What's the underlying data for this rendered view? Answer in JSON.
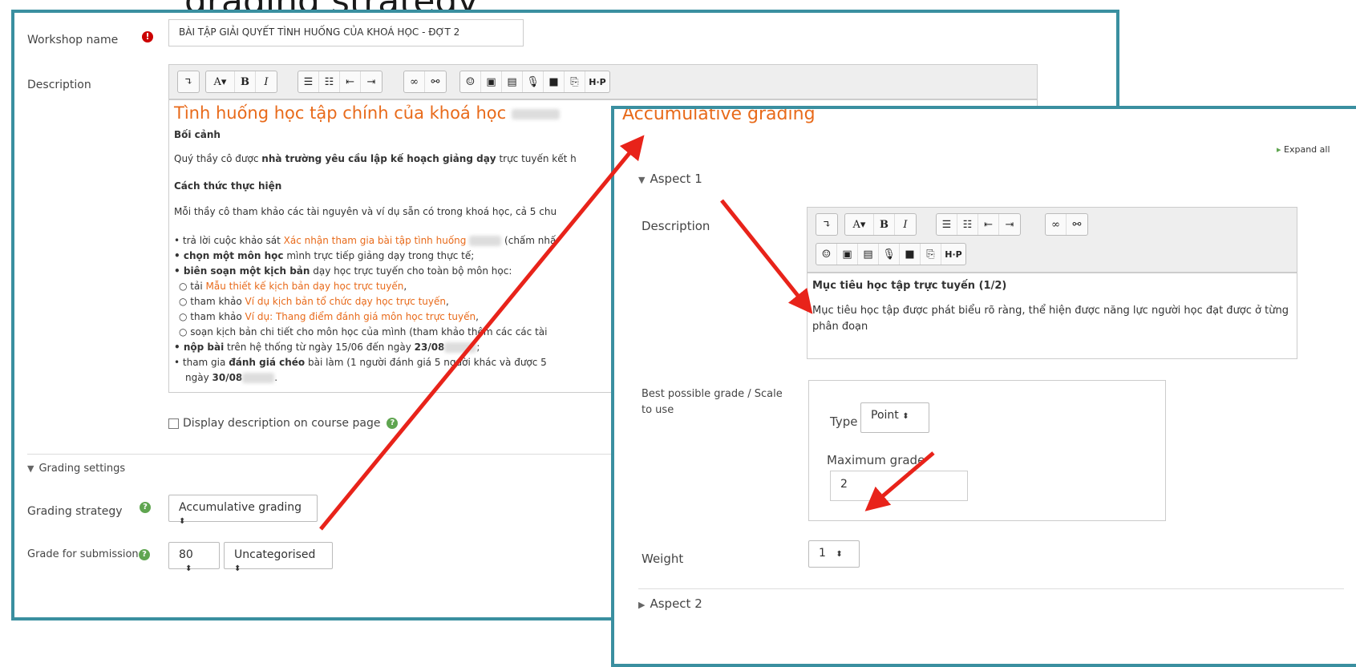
{
  "heading_partial": "grading strategy",
  "left": {
    "workshop_name_label": "Workshop name",
    "workshop_name_value": "BÀI TẬP GIẢI QUYẾT TÌNH HUỐNG CỦA KHOÁ HỌC - ĐỢT 2",
    "description_label": "Description",
    "editor": {
      "title": "Tình huống học tập chính của khoá học",
      "context_heading": "Bối cảnh",
      "context_text_prefix": "Quý thầy cô được ",
      "context_text_bold": "nhà trường yêu cầu lập kế hoạch giảng dạy",
      "context_text_suffix": " trực tuyến kết h",
      "method_heading": "Cách thức thực hiện",
      "method_text": "Mỗi thầy cô tham khảo các tài nguyên và ví dụ sẵn có trong khoá học, cả 5 chu",
      "b1_prefix": "• trả lời cuộc khảo sát ",
      "b1_link": "Xác nhận tham gia bài tập tình huống",
      "b1_suffix": " (chấm nhấ",
      "b2_bold": "• chọn một môn học",
      "b2_text": " mình trực tiếp giảng dạy trong thực tế;",
      "b3_bold": "• biên soạn một kịch bản",
      "b3_text": " dạy học trực tuyến cho toàn bộ môn học:",
      "s1_prefix": "○ tải ",
      "s1_link": "Mẫu thiết kế kịch bản dạy học trực tuyến",
      "s1_suffix": ",",
      "s2_prefix": "○ tham khảo ",
      "s2_link": "Ví dụ kịch bản tổ chức dạy học trực tuyến",
      "s2_suffix": ",",
      "s3_prefix": "○ tham khảo ",
      "s3_link": "Ví dụ: Thang điểm đánh giá môn học trực tuyến",
      "s3_suffix": ",",
      "s4_text": "○ soạn kịch bản chi tiết cho môn học của mình (tham khảo thêm các các tài",
      "b4_bold": "• nộp bài",
      "b4_text": " trên hệ thống từ ngày 15/06 đến ngày ",
      "b4_date": "23/08",
      "b4_end": ";",
      "b5_prefix": "• tham gia ",
      "b5_bold": "đánh giá chéo",
      "b5_text": " bài làm (1 người đánh giá 5 người khác và được 5",
      "b5_line2_prefix": "ngày ",
      "b5_line2_date": "30/08",
      "b5_line2_end": "."
    },
    "display_desc_label": "Display description on course page",
    "grading_settings_label": "Grading settings",
    "grading_strategy_label": "Grading strategy",
    "grading_strategy_value": "Accumulative grading",
    "grade_submission_label": "Grade for submission",
    "grade_value": "80",
    "grade_category": "Uncategorised"
  },
  "right": {
    "title": "Accumulative grading",
    "expand_all": "Expand all",
    "aspect1": "Aspect 1",
    "description_label": "Description",
    "editor_title": "Mục tiêu học tập trực tuyến (1/2)",
    "editor_body": "Mục tiêu học tập được phát biểu rõ ràng, thể hiện được năng lực người học đạt được ở từng phân đoạn",
    "best_grade_label": "Best possible grade / Scale to use",
    "type_label": "Type",
    "type_value": "Point",
    "max_grade_label": "Maximum grade",
    "max_grade_value": "2",
    "weight_label": "Weight",
    "weight_value": "1",
    "aspect2": "Aspect 2"
  },
  "colors": {
    "panel_border": "#3a8fa0",
    "accent": "#e86a1a",
    "arrow": "#e8231a"
  }
}
